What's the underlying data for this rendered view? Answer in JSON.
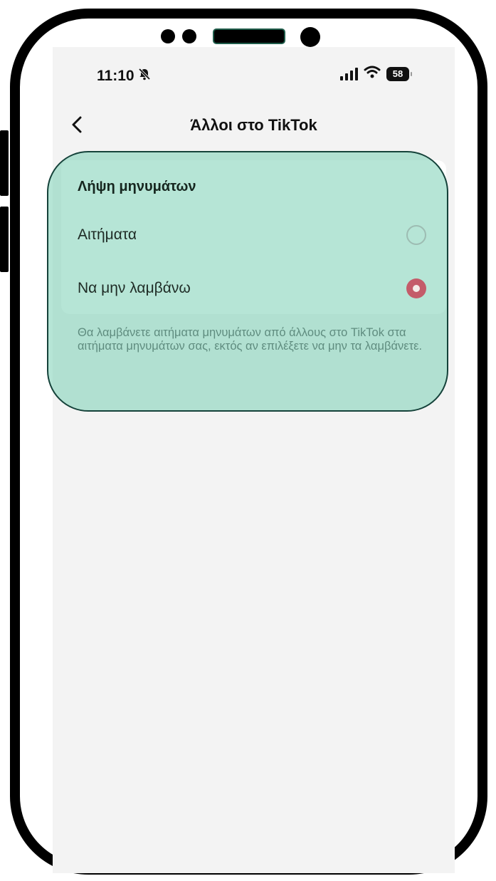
{
  "status_bar": {
    "time": "11:10",
    "battery": "58"
  },
  "nav": {
    "title": "Άλλοι στο TikTok"
  },
  "section": {
    "title": "Λήψη μηνυμάτων",
    "options": [
      {
        "label": "Αιτήματα",
        "selected": false
      },
      {
        "label": "Να μην λαμβάνω",
        "selected": true
      }
    ],
    "description": "Θα λαμβάνετε αιτήματα μηνυμάτων από άλλους στο TikTok στα αιτήματα μηνυμάτων σας, εκτός αν επιλέξετε να μην τα λαμβάνετε."
  },
  "colors": {
    "highlight": "#a7dcc8",
    "highlight_border": "#15423a",
    "radio_selected": "#c45c6a",
    "screen_bg": "#f3f3f3"
  },
  "icons": {
    "silent": "bell-slash-icon",
    "signal": "signal-bars-icon",
    "wifi": "wifi-icon",
    "battery": "battery-icon",
    "back": "chevron-left-icon"
  }
}
